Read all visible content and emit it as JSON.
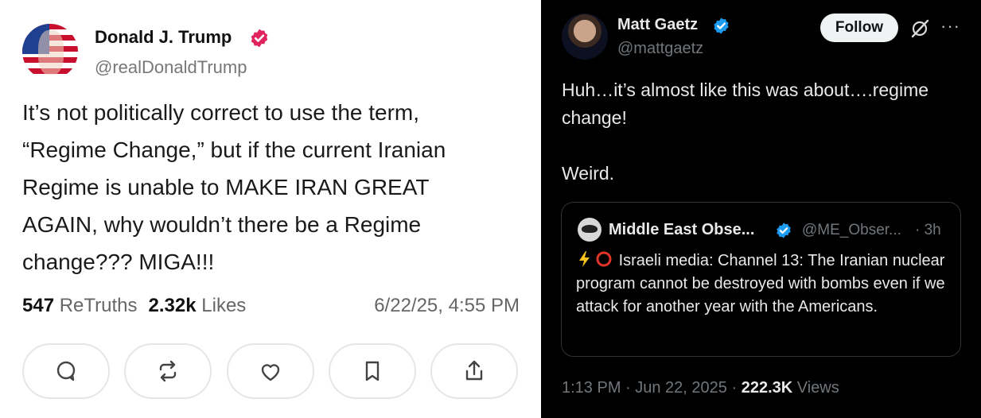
{
  "left_post": {
    "author_name": "Donald J. Trump",
    "handle": "@realDonaldTrump",
    "body": "It’s not politically correct to use the term,\n“Regime Change,” but if the current Iranian\nRegime is unable to MAKE IRAN GREAT\nAGAIN, why wouldn’t there be a Regime\nchange??? MIGA!!!",
    "retruths_count": "547",
    "retruths_label": "ReTruths",
    "likes_count": "2.32k",
    "likes_label": "Likes",
    "timestamp": "6/22/25, 4:55 PM",
    "verified_color": "#e0245e",
    "actions": [
      "reply-icon",
      "retruth-icon",
      "like-icon",
      "bookmark-icon",
      "share-icon"
    ]
  },
  "right_post": {
    "author_name": "Matt Gaetz",
    "handle": "@mattgaetz",
    "follow_label": "Follow",
    "more_label": "···",
    "body": "Huh…it’s almost like this was about….regime\nchange!\n\nWeird.",
    "verified_color": "#1d9bf0",
    "quote": {
      "author_name": "Middle East Obse...",
      "handle": "@ME_Obser...",
      "time": "· 3h",
      "body": "Israeli media: Channel 13: The Iranian nuclear program cannot be destroyed with bombs even if we attack for another year with the Americans."
    },
    "time": "1:13 PM · Jun 22, 2025 ·",
    "views_count": "222.3K",
    "views_label": "Views"
  }
}
